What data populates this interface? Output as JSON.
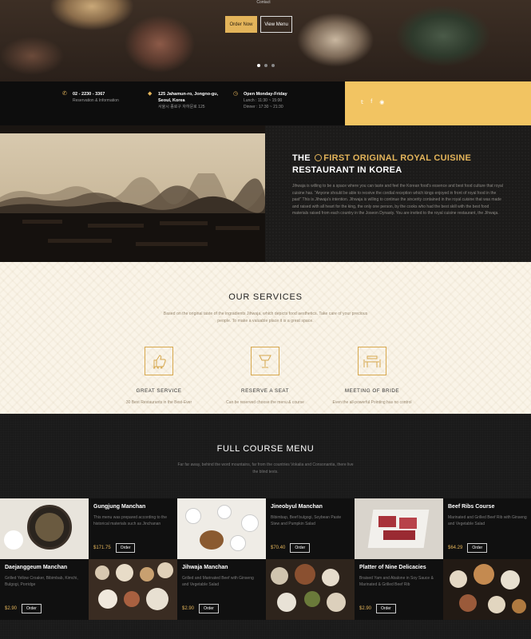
{
  "hero": {
    "top_text": "Contact",
    "order_label": "Order Now",
    "view_label": "View Menu",
    "slide_count": 3
  },
  "info": {
    "phone": "02 - 2230 - 3367",
    "phone_sub": "Reservation & Information",
    "address_line1": "125 Jahamun-ro, Jongno-gu,",
    "address_line2": "Seoul, Korea",
    "address_korean": "서울시 종로구 자하문로 125",
    "hours_title": "Open Monday-Friday",
    "hours_lunch": "Lunch : 11:30 ~ 15:00",
    "hours_dinner": "Dinner : 17:30 ~ 21:30",
    "social": [
      "twitter",
      "facebook",
      "instagram"
    ]
  },
  "about": {
    "title_pre": "THE",
    "title_gold": "FIRST ORIGINAL ROYAL CUISINE",
    "title_line2": "RESTAURANT IN KOREA",
    "body": "Jihwaja is willing to be a space where you can taste and feel the Korean food's essence and best food culture that royal cuisine has. \"Anyone should be able to receive the cordial reception which kings enjoyed in front of royal food in the past\" This is Jihwaja's intention. Jihwaja is willing to continue the sincerity contained in the royal cuisine that was made and raised with all heart for the king, the only one person, by the cooks who had the best skill with the best food materials raised from each country in the Joseon Dynasty. You are invited to the royal cuisine restaurant, the Jihwaja."
  },
  "services": {
    "title": "OUR SERVICES",
    "desc": "Based on the original taste of the ingradients Jihwaja, which depicts food aesthetics. Take care of your precious people. To make a valuable place it is a great space.",
    "items": [
      {
        "name": "GREAT SERVICE",
        "sub": "30 Best Restaurants in the Best-Ever",
        "icon": "thumbs-up-stars-icon"
      },
      {
        "name": "RESERVE A SEAT",
        "sub": "Can be reserved choose the menu & course",
        "icon": "reserved-sign-icon"
      },
      {
        "name": "MEETING OF BRIDE",
        "sub": "Even the all-powerful Pointing has no control",
        "icon": "dining-table-icon"
      }
    ]
  },
  "menu": {
    "title": "FULL COURSE MENU",
    "desc": "Far far away, behind the word mountains, far from the countries Vokalia and Consonantia, there live the blind texts.",
    "order_label": "Order",
    "items": [
      {
        "name": "Gungjung Manchan",
        "desc": "This menu was prepared according to the historical materials such as Jinchanan",
        "price": "$171.75"
      },
      {
        "name": "Jineobyul Manchan",
        "desc": "Bibimbap, Beef bulgogi, Soybean Paste Stew and Pumpkin Salad",
        "price": "$70.40"
      },
      {
        "name": "Beef Ribs Course",
        "desc": "Marinated and Grilled Beef Rib with Ginseng and Vegetable Salad",
        "price": "$64.29"
      },
      {
        "name": "Daejanggeum Manchan",
        "desc": "Grilled Yellow Croaker, Bibimbab, Kimchi, Bulgogi, Porridge",
        "price": "$2.90"
      },
      {
        "name": "Jihwaja Manchan",
        "desc": "Grilled and Marinated Beef with Ginseng and Vegetable Salad",
        "price": "$2.90"
      },
      {
        "name": "Platter of Nine Delicacies",
        "desc": "Braised Yam and Abalone in Soy Sauce & Marinated & Grilled Beef Rib",
        "price": "$2.90"
      }
    ]
  },
  "colors": {
    "accent": "#e3b45a",
    "gold_block": "#f2c462",
    "dark": "#141414",
    "cream": "#faf4e8"
  }
}
